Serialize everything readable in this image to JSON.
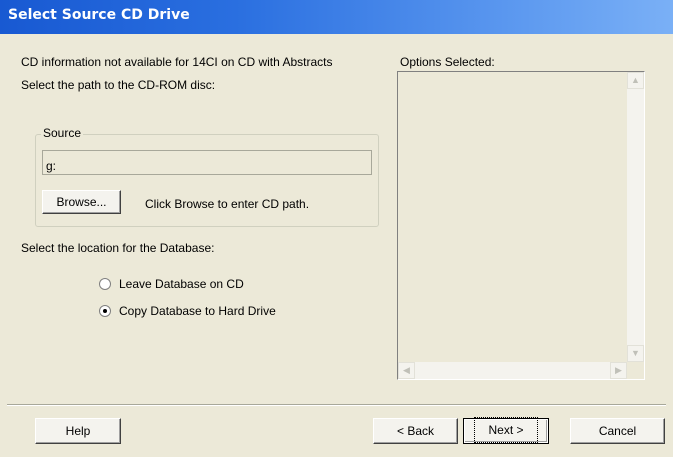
{
  "window": {
    "title": "Select Source CD Drive"
  },
  "info": {
    "cd_message": "CD information not available for 14CI on CD with Abstracts",
    "path_prompt": "Select the path to the CD-ROM disc:"
  },
  "source": {
    "group_label": "Source",
    "path_value": "g:",
    "browse_label": "Browse...",
    "browse_hint": "Click Browse to enter CD path."
  },
  "database": {
    "prompt": "Select the location for the Database:",
    "options": [
      {
        "label": "Leave Database on CD",
        "selected": false
      },
      {
        "label": "Copy Database to Hard Drive",
        "selected": true
      }
    ]
  },
  "options_panel": {
    "label": "Options Selected:"
  },
  "buttons": {
    "help": "Help",
    "back": "< Back",
    "next": "Next >",
    "cancel": "Cancel"
  },
  "colors": {
    "title_bar": "#2a6fe0",
    "dialog_bg": "#ece9d8"
  }
}
